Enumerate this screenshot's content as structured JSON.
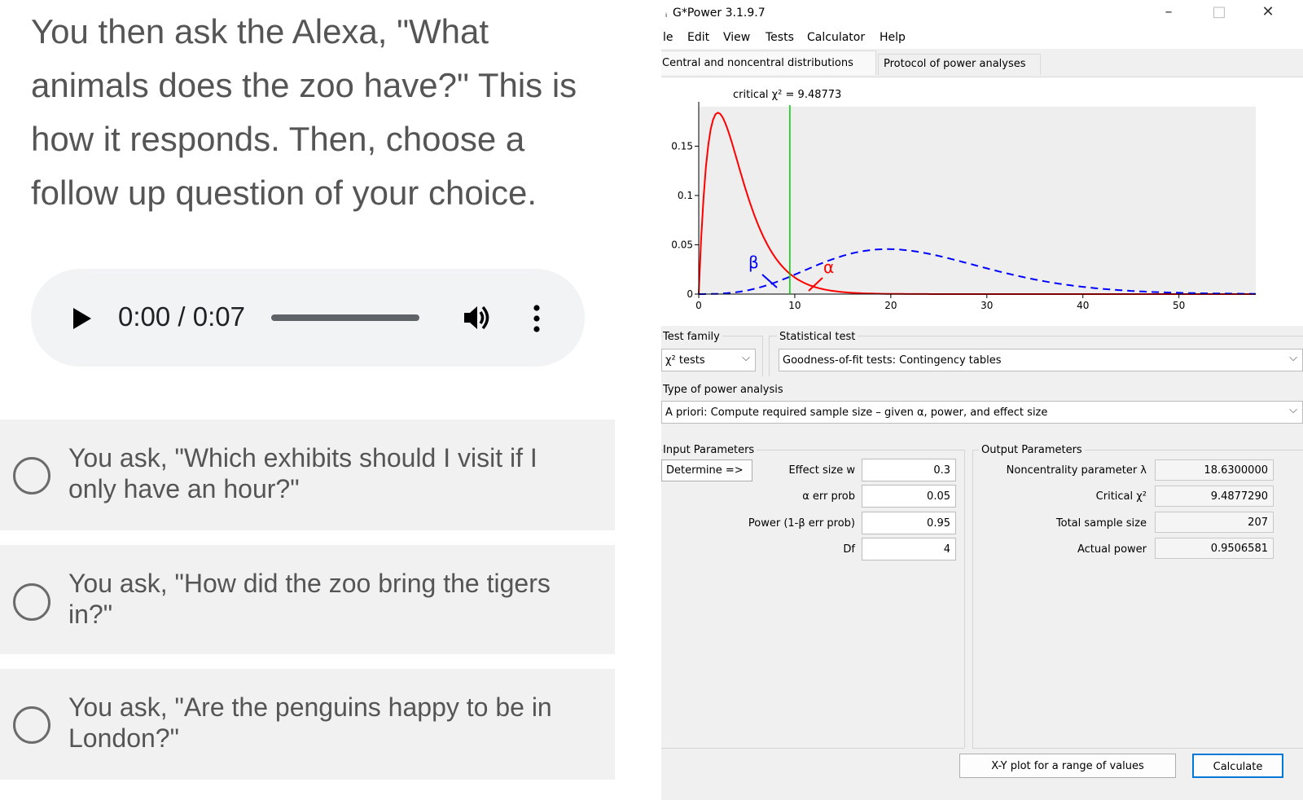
{
  "survey": {
    "question": "You then ask the Alexa, \"What animals does the zoo have?\" This is how it responds. Then, choose a follow up question of your choice.",
    "audio": {
      "time_display": "0:00 / 0:07",
      "play_icon": "play-icon",
      "volume_icon": "volume-icon",
      "menu_icon": "more-vert-icon"
    },
    "options": [
      {
        "label": "You ask, \"Which exhibits should I visit if I only have an hour?\""
      },
      {
        "label": "You ask, \"How did the zoo bring the tigers in?\""
      },
      {
        "label": "You ask, \"Are the penguins happy to be in London?\""
      }
    ]
  },
  "gpower": {
    "title": "G*Power 3.1.9.7",
    "window_controls": {
      "minimize": "–",
      "maximize": "□",
      "close": "✕"
    },
    "menu": [
      "le",
      "Edit",
      "View",
      "Tests",
      "Calculator",
      "Help"
    ],
    "tabs": [
      "Central and noncentral distributions",
      "Protocol of power analyses"
    ],
    "plot": {
      "critical_label": "critical χ² = 9.48773",
      "beta_label": "β",
      "alpha_label": "α",
      "critical_value": 9.48773,
      "x_ticks": [
        "0",
        "10",
        "20",
        "30",
        "40",
        "50"
      ],
      "y_ticks": [
        "0",
        "0.05",
        "0.1",
        "0.15"
      ],
      "x_max": 58,
      "y_max": 0.19,
      "df": 4,
      "noncentrality": 18.63,
      "colors": {
        "central": "#ff0000",
        "noncentral": "#0000ff",
        "critical": "#00cc00"
      }
    },
    "test_family_label": "Test family",
    "test_family_value": "χ² tests",
    "statistical_test_label": "Statistical test",
    "statistical_test_value": "Goodness-of-fit tests: Contingency tables",
    "power_analysis_label": "Type of power analysis",
    "power_analysis_value": "A priori: Compute required sample size – given α, power, and effect size",
    "input": {
      "title": "Input Parameters",
      "determine_button": "Determine =>",
      "fields": [
        {
          "label": "Effect size w",
          "value": "0.3"
        },
        {
          "label": "α err prob",
          "value": "0.05"
        },
        {
          "label": "Power (1-β err prob)",
          "value": "0.95"
        },
        {
          "label": "Df",
          "value": "4"
        }
      ]
    },
    "output": {
      "title": "Output Parameters",
      "fields": [
        {
          "label": "Noncentrality parameter λ",
          "value": "18.6300000"
        },
        {
          "label": "Critical χ²",
          "value": "9.4877290"
        },
        {
          "label": "Total sample size",
          "value": "207"
        },
        {
          "label": "Actual power",
          "value": "0.9506581"
        }
      ]
    },
    "xy_plot_button": "X-Y plot for a range of values",
    "calculate_button": "Calculate"
  }
}
